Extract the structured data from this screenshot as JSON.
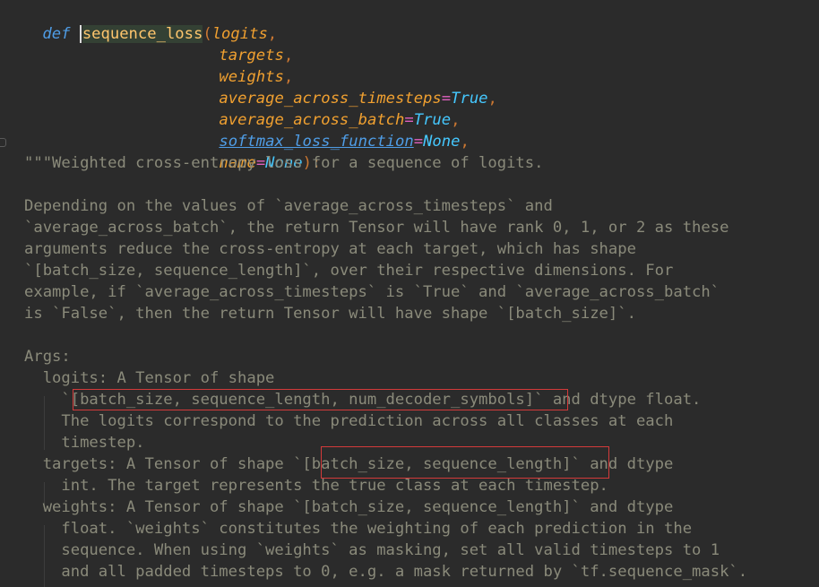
{
  "code": {
    "def_keyword": "def",
    "function_name": "sequence_loss",
    "open_paren": "(",
    "params": [
      {
        "name": "logits",
        "suffix": ","
      },
      {
        "name": "targets",
        "suffix": ","
      },
      {
        "name": "weights",
        "suffix": ","
      },
      {
        "name": "average_across_timesteps",
        "equals": "=",
        "default": "True",
        "suffix": ","
      },
      {
        "name": "average_across_batch",
        "equals": "=",
        "default": "True",
        "suffix": ","
      },
      {
        "name": "softmax_loss_function",
        "equals": "=",
        "default": "None",
        "suffix": ","
      },
      {
        "name": "name",
        "equals": "=",
        "default": "None",
        "suffix": "):"
      }
    ]
  },
  "docstring": {
    "lines": [
      "\"\"\"Weighted cross-entropy loss for a sequence of logits.",
      "",
      "Depending on the values of `average_across_timesteps` and",
      "`average_across_batch`, the return Tensor will have rank 0, 1, or 2 as these",
      "arguments reduce the cross-entropy at each target, which has shape",
      "`[batch_size, sequence_length]`, over their respective dimensions. For",
      "example, if `average_across_timesteps` is `True` and `average_across_batch`",
      "is `False`, then the return Tensor will have shape `[batch_size]`.",
      "",
      "Args:",
      "  logits: A Tensor of shape",
      "    `[batch_size, sequence_length, num_decoder_symbols]` and dtype float.",
      "    The logits correspond to the prediction across all classes at each",
      "    timestep.",
      "  targets: A Tensor of shape `[batch_size, sequence_length]` and dtype",
      "    int. The target represents the true class at each timestep.",
      "  weights: A Tensor of shape `[batch_size, sequence_length]` and dtype",
      "    float. `weights` constitutes the weighting of each prediction in the",
      "    sequence. When using `weights` as masking, set all valid timesteps to 1",
      "    and all padded timesteps to 0, e.g. a mask returned by `tf.sequence_mask`."
    ]
  }
}
